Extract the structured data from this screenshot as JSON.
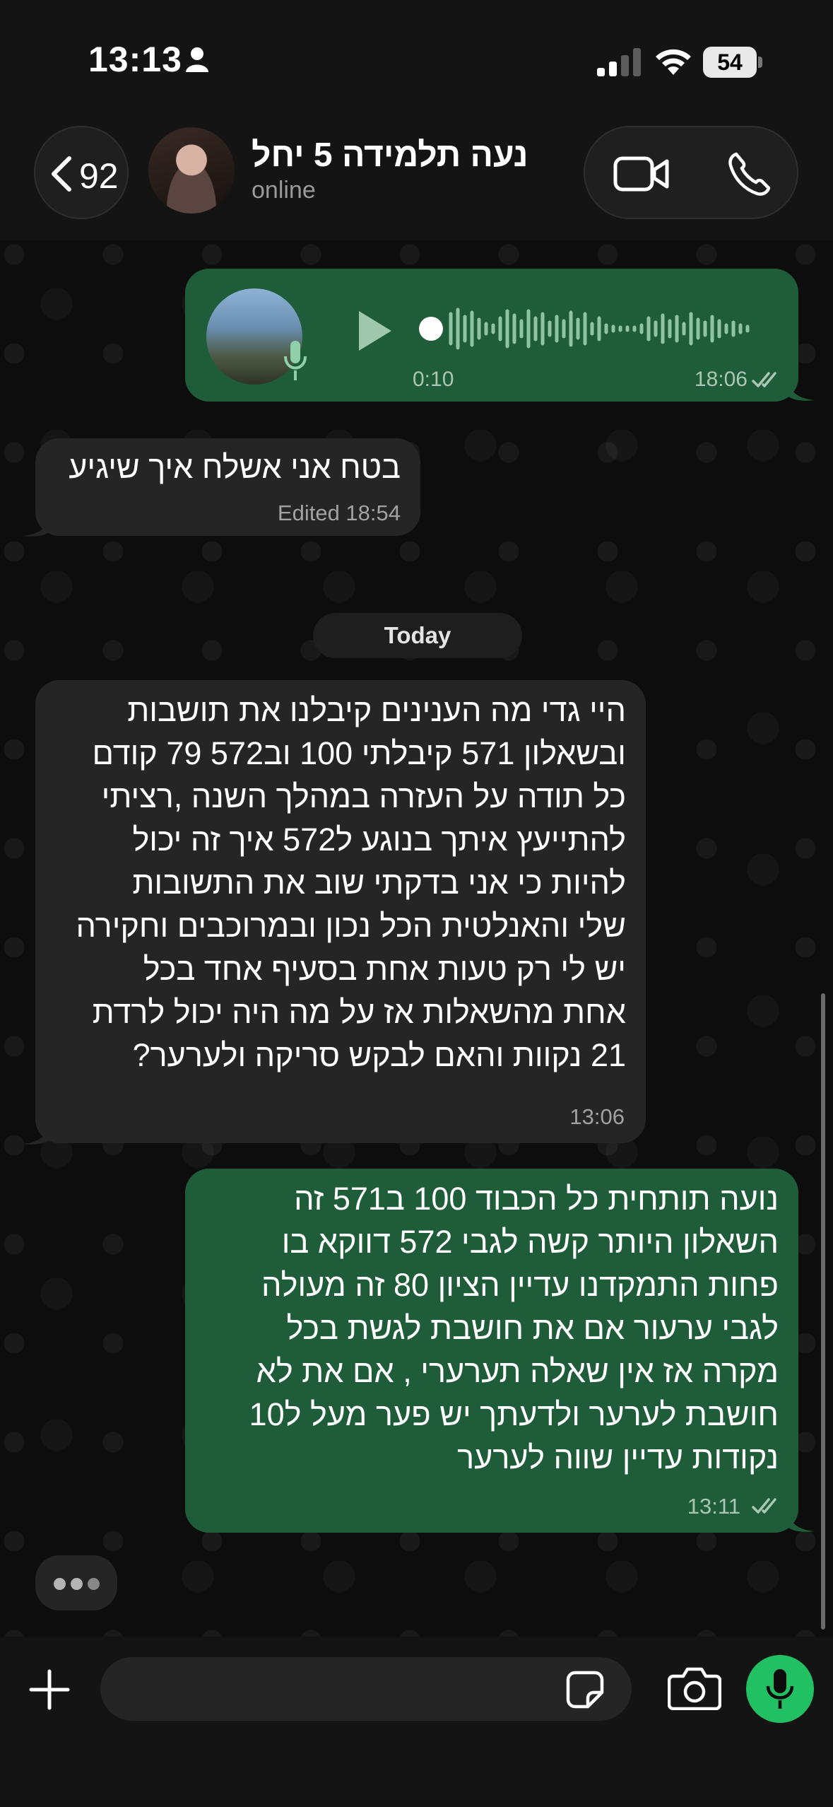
{
  "status_bar": {
    "time": "13:13",
    "battery": "54"
  },
  "header": {
    "back_count": "92",
    "contact_name": "נעה תלמידה 5 יחל",
    "contact_status": "online"
  },
  "messages": [
    {
      "type": "voice",
      "direction": "outgoing",
      "duration": "0:10",
      "time": "18:06",
      "read": true
    },
    {
      "type": "text",
      "direction": "incoming",
      "lines": [
        "בטח אני אשלח איך שיגיע"
      ],
      "meta": "Edited 18:54"
    },
    {
      "type": "text",
      "direction": "incoming",
      "lines": [
        "היי גדי מה הענינים קיבלנו את תושבות",
        "ובשאלון 571 קיבלתי 100 וב572 79 קודם",
        "כל תודה על העזרה במהלך השנה ,רציתי",
        "להתייעץ איתך בנוגע ל572 איך זה יכול",
        "להיות כי אני בדקתי שוב את התשובות",
        "שלי והאנלטית הכל נכון ובמרוכבים וחקירה",
        "יש לי רק טעות אחת בסעיף אחד בכל",
        "אחת מהשאלות אז על מה היה יכול לרדת",
        "21 נקוות והאם לבקש סריקה ולערער?"
      ],
      "meta": "13:06"
    },
    {
      "type": "text",
      "direction": "outgoing",
      "lines": [
        "נועה תותחית כל הכבוד 100 ב571 זה",
        "השאלון היותר קשה לגבי 572 דווקא בו",
        "פחות התמקדנו עדיין הציון 80 זה מעולה",
        "לגבי ערעור אם את חושבת לגשת בכל",
        "מקרה אז אין שאלה תערערי , אם את לא",
        "חושבת לערער ולדעתך יש פער מעל ל10",
        "נקודות עדיין שווה לערער"
      ],
      "meta": "13:11",
      "read": true
    }
  ],
  "date_separator": "Today",
  "composer": {
    "placeholder": ""
  },
  "colors": {
    "outgoing_bubble": "#1f5c3a",
    "incoming_bubble": "#252525",
    "accent_green": "#21c063",
    "read_ticks": "#a9c7b4"
  },
  "icons": [
    "person-icon",
    "signal-icon",
    "wifi-icon",
    "battery-icon",
    "chevron-left-icon",
    "video-call-icon",
    "phone-icon",
    "play-icon",
    "mic-icon",
    "double-check-icon",
    "plus-icon",
    "sticker-icon",
    "camera-icon"
  ]
}
